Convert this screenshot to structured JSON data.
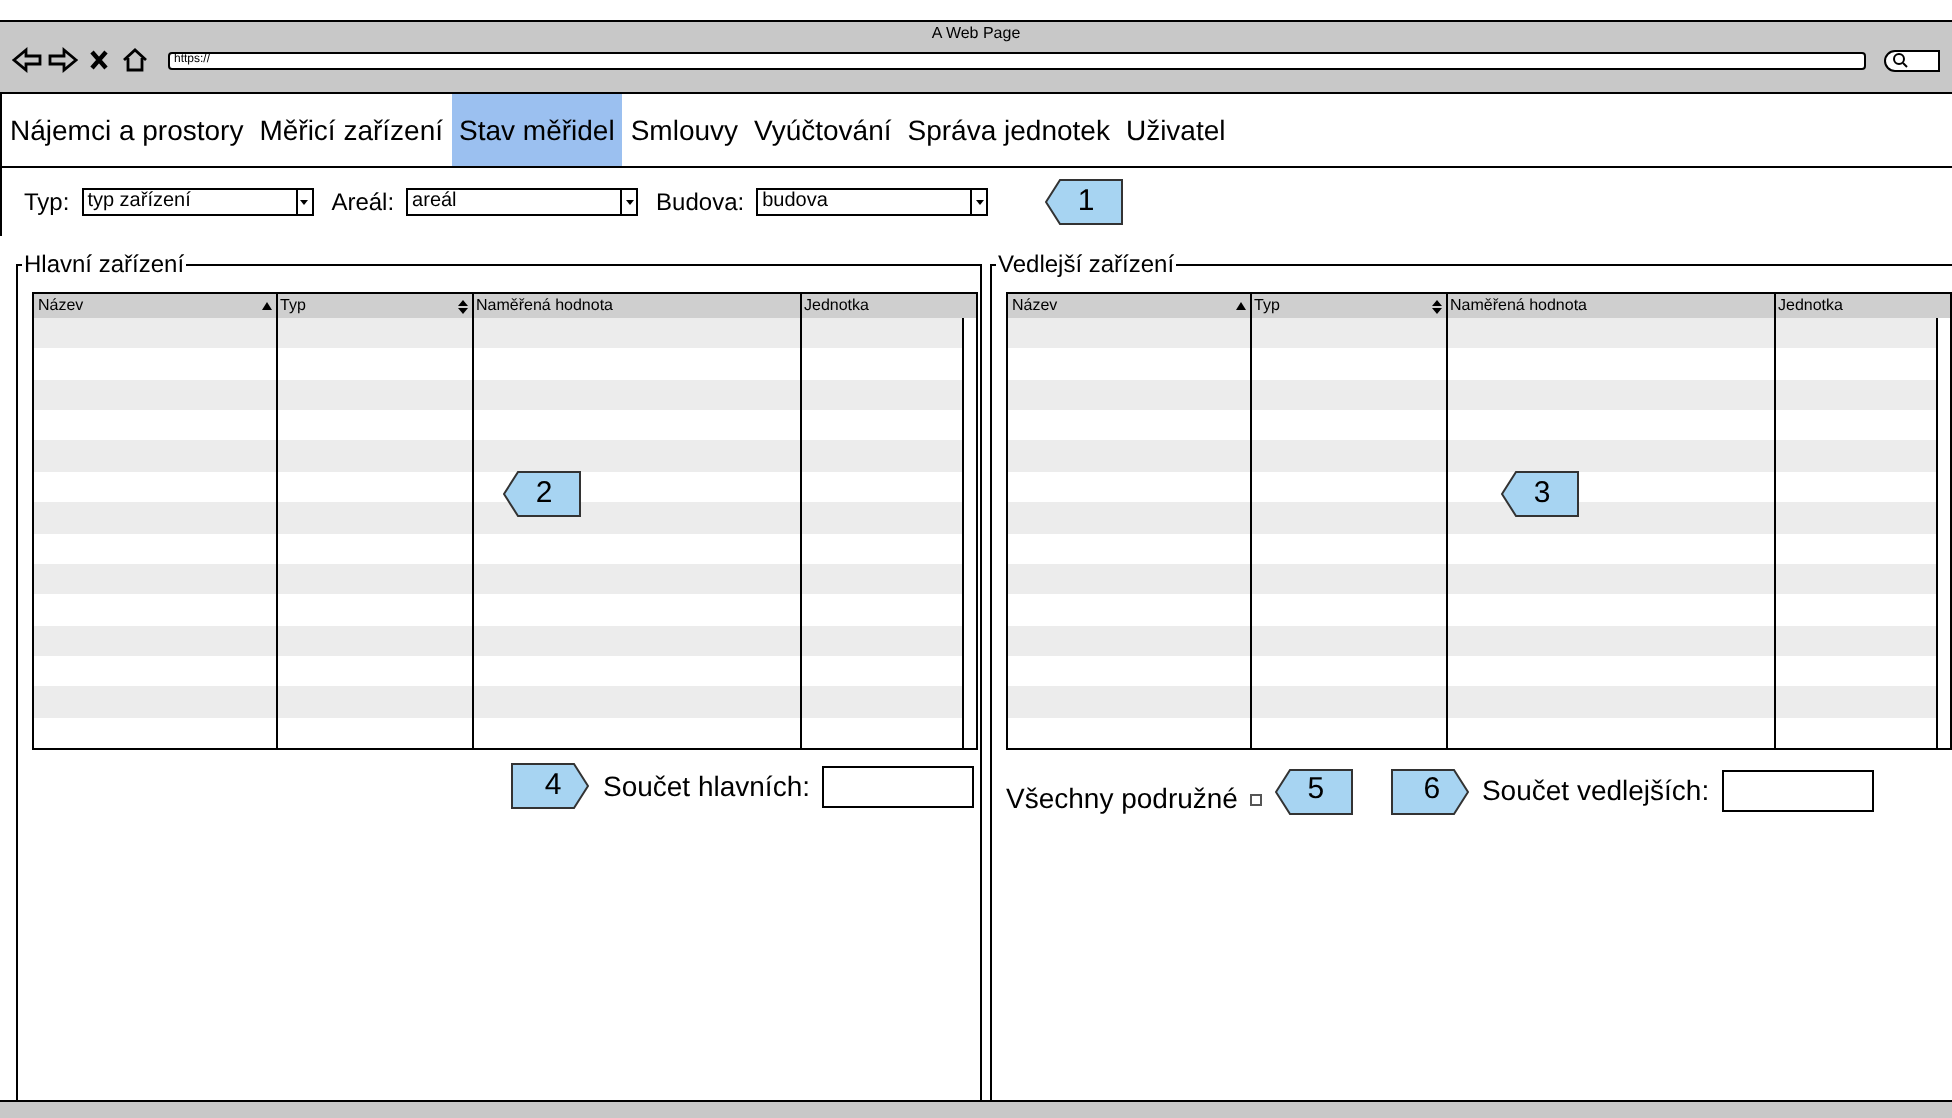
{
  "window": {
    "title": "A Web Page",
    "address": "https://"
  },
  "nav": [
    {
      "label": "Nájemci a prostory",
      "selected": false
    },
    {
      "label": "Měřicí zařízení",
      "selected": false
    },
    {
      "label": "Stav měřidel",
      "selected": true
    },
    {
      "label": "Smlouvy",
      "selected": false
    },
    {
      "label": "Vyúčtování",
      "selected": false
    },
    {
      "label": "Správa jednotek",
      "selected": false
    },
    {
      "label": "Uživatel",
      "selected": false
    }
  ],
  "filters": [
    {
      "label": "Typ:",
      "value": "typ zařízení"
    },
    {
      "label": "Areál:",
      "value": "areál"
    },
    {
      "label": "Budova:",
      "value": "budova"
    }
  ],
  "filter_callout": "1",
  "panels": [
    {
      "title": "Hlavní zařízení",
      "callout": "2",
      "columns": [
        {
          "label": "Název",
          "kind": "ascending"
        },
        {
          "label": "Typ",
          "kind": "sortable"
        },
        {
          "label": "Naměřená hodnota",
          "kind": "plain"
        },
        {
          "label": "Jednotka",
          "kind": "plain"
        }
      ],
      "footer": [
        {
          "kind": "callout-right",
          "text": "4"
        },
        {
          "kind": "sum",
          "label": "Součet hlavních:"
        }
      ]
    },
    {
      "title": "Vedlejší zařízení",
      "callout": "3",
      "columns": [
        {
          "label": "Název",
          "kind": "ascending"
        },
        {
          "label": "Typ",
          "kind": "sortable"
        },
        {
          "label": "Naměřená hodnota",
          "kind": "plain"
        },
        {
          "label": "Jednotka",
          "kind": "plain"
        }
      ],
      "footer": [
        {
          "kind": "checkbox",
          "label": "Všechny podružné",
          "checked": false
        },
        {
          "kind": "callout-left",
          "text": "5"
        },
        {
          "kind": "callout-right",
          "text": "6"
        },
        {
          "kind": "sum",
          "label": "Součet vedlejších:"
        }
      ]
    }
  ]
}
